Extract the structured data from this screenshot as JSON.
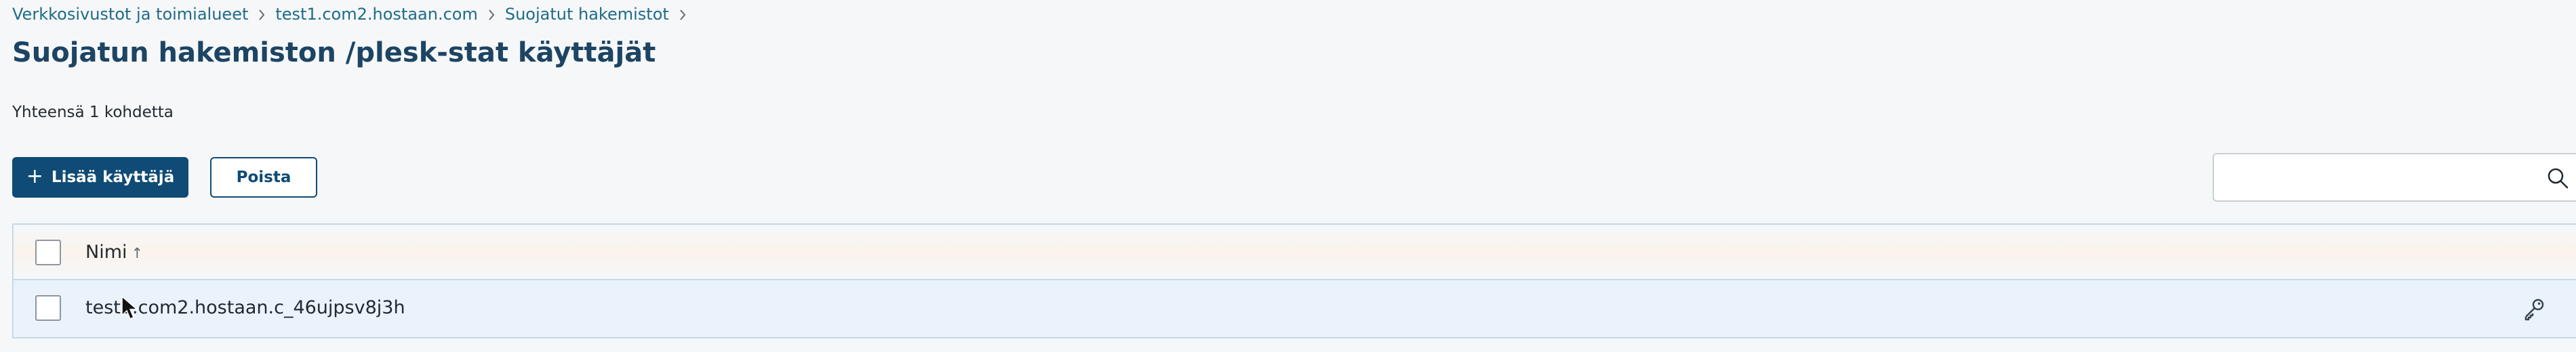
{
  "breadcrumb": {
    "items": [
      {
        "label": "Verkkosivustot ja toimialueet"
      },
      {
        "label": "test1.com2.hostaan.com"
      },
      {
        "label": "Suojatut hakemistot"
      }
    ]
  },
  "page": {
    "title": "Suojatun hakemiston /plesk-stat käyttäjät",
    "total": "Yhteensä 1 kohdetta"
  },
  "toolbar": {
    "add_icon": "+",
    "add_label": "Lisää käyttäjä",
    "delete_label": "Poista"
  },
  "search": {
    "value": "",
    "placeholder": "",
    "icon": "search-icon"
  },
  "table": {
    "columns": [
      {
        "label": "Nimi",
        "sort": "↑"
      }
    ],
    "rows": [
      {
        "name": "test1.com2.hostaan.c_46ujpsv8j3h",
        "action_icon": "key-icon"
      }
    ]
  },
  "colors": {
    "accent": "#0f4b75",
    "title": "#1d4463",
    "link": "#1f6b88",
    "row_highlight": "#eaf3fb",
    "border": "#c6d9e6"
  }
}
